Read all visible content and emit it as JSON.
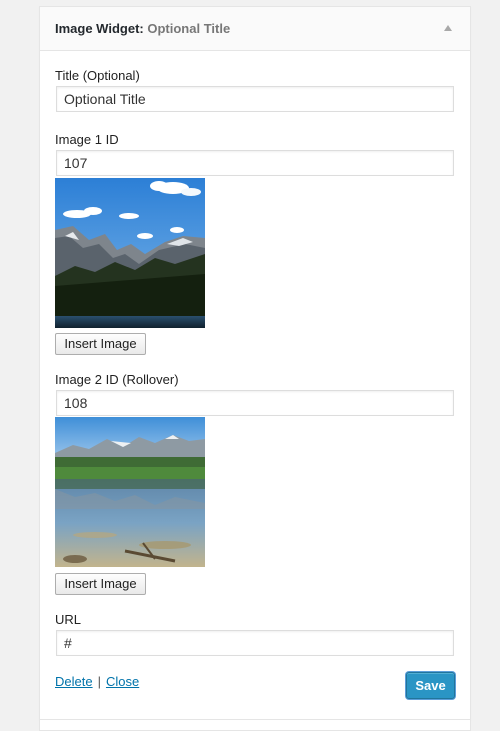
{
  "widget": {
    "title": "Image Widget",
    "title_separator": ": ",
    "subtitle": "Optional Title",
    "collapse_icon": "triangle-up-icon"
  },
  "fields": {
    "title": {
      "label": "Title (Optional)",
      "value": "Optional Title"
    },
    "image1": {
      "label": "Image 1 ID",
      "value": "107",
      "preview": "mountain-landscape-image",
      "insert_button": "Insert Image"
    },
    "image2": {
      "label": "Image 2 ID (Rollover)",
      "value": "108",
      "preview": "lake-reflection-image",
      "insert_button": "Insert Image"
    },
    "url": {
      "label": "URL",
      "value": "#"
    }
  },
  "actions": {
    "delete": "Delete",
    "separator": "|",
    "close": "Close",
    "save": "Save"
  },
  "colors": {
    "link": "#0073aa",
    "primary_button": "#2a95c5",
    "page_background": "#f1f1f1"
  }
}
